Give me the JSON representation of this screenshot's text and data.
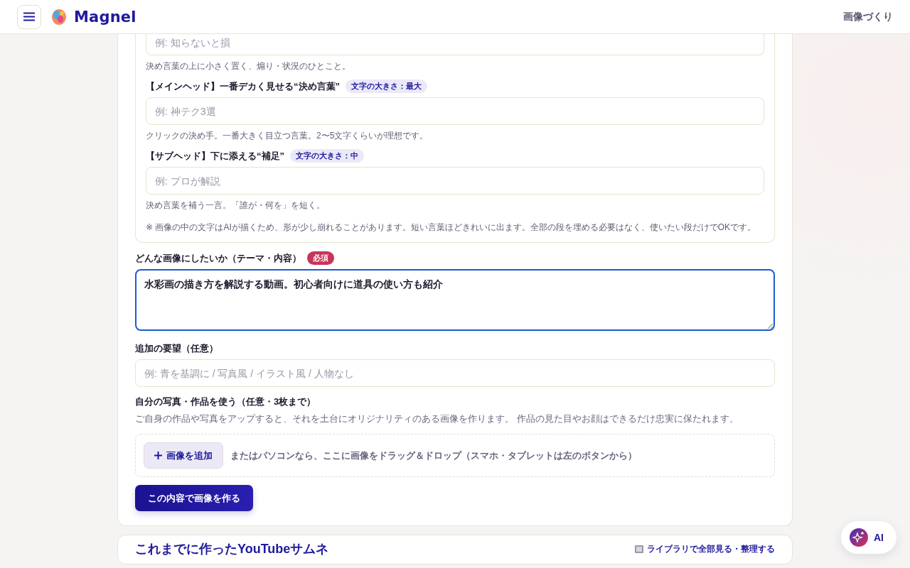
{
  "header": {
    "logo": "Magnel",
    "nav_link": "画像づくり"
  },
  "text_layers": {
    "fields": [
      {
        "placeholder": "例: 知らないと損",
        "hint": "決め言葉の上に小さく置く、煽り・状況のひとこと。"
      },
      {
        "label": "【メインヘッド】一番デカく見せる“決め言葉”",
        "badge": "文字の大きさ：最大",
        "placeholder": "例: 神テク3選",
        "hint": "クリックの決め手。一番大きく目立つ言葉。2〜5文字くらいが理想です。"
      },
      {
        "label": "【サブヘッド】下に添える“補足”",
        "badge": "文字の大きさ：中",
        "placeholder": "例: プロが解説",
        "hint": "決め言葉を補う一言。「誰が・何を」を短く。"
      }
    ],
    "note": "※ 画像の中の文字はAIが描くため、形が少し崩れることがあります。短い言葉ほどきれいに出ます。全部の段を埋める必要はなく、使いたい段だけでOKです。"
  },
  "theme": {
    "label": "どんな画像にしたいか（テーマ・内容）",
    "badge": "必須",
    "value": "水彩画の描き方を解説する動画。初心者向けに道具の使い方も紹介",
    "focused": true
  },
  "requests": {
    "label": "追加の要望（任意）",
    "placeholder": "例: 青を基調に / 写真風 / イラスト風 / 人物なし"
  },
  "photos": {
    "label": "自分の写真・作品を使う（任意・3枚まで）",
    "description": "ご自身の作品や写真をアップすると、それを土台にオリジナリティのある画像を作ります。 作品の見た目やお顔はできるだけ忠実に保たれます。",
    "add_button": "画像を追加",
    "drop_hint": "またはパソコンなら、ここに画像をドラッグ＆ドロップ（スマホ・タブレットは左のボタンから）"
  },
  "submit_button": "この内容で画像を作る",
  "history": {
    "title": "これまでに作ったYouTubeサムネ",
    "library_link": "ライブラリで全部見る・整理する"
  },
  "ai_button": "AI"
}
